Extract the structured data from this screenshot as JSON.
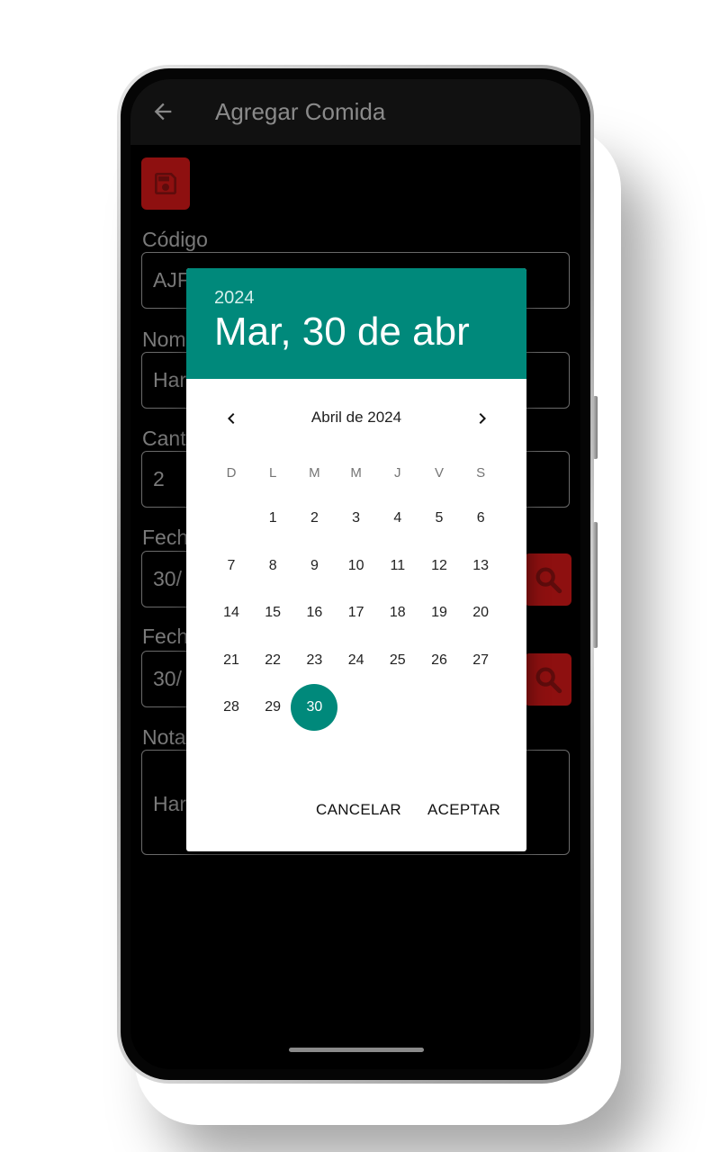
{
  "app_bar": {
    "title": "Agregar Comida"
  },
  "form": {
    "codigo_label": "Código",
    "codigo_value": "AJF",
    "nombre_label": "Nom",
    "nombre_value": "Har",
    "cantidad_label": "Cant",
    "cantidad_value": "2",
    "fecha1_label": "Fech",
    "fecha1_value": "30/",
    "fecha2_label": "Fech",
    "fecha2_value": "30/",
    "notas_label": "Nota",
    "notas_value": "Har"
  },
  "date_picker": {
    "year": "2024",
    "selected_date": "Mar, 30 de abr",
    "month_label": "Abril de 2024",
    "weekdays": [
      "D",
      "L",
      "M",
      "M",
      "J",
      "V",
      "S"
    ],
    "first_weekday_offset": 1,
    "days": [
      "1",
      "2",
      "3",
      "4",
      "5",
      "6",
      "7",
      "8",
      "9",
      "10",
      "11",
      "12",
      "13",
      "14",
      "15",
      "16",
      "17",
      "18",
      "19",
      "20",
      "21",
      "22",
      "23",
      "24",
      "25",
      "26",
      "27",
      "28",
      "29",
      "30"
    ],
    "selected_day": "30",
    "cancel_label": "CANCELAR",
    "accept_label": "ACEPTAR"
  },
  "colors": {
    "header": "#00897b",
    "accent_red": "#8e1010"
  }
}
